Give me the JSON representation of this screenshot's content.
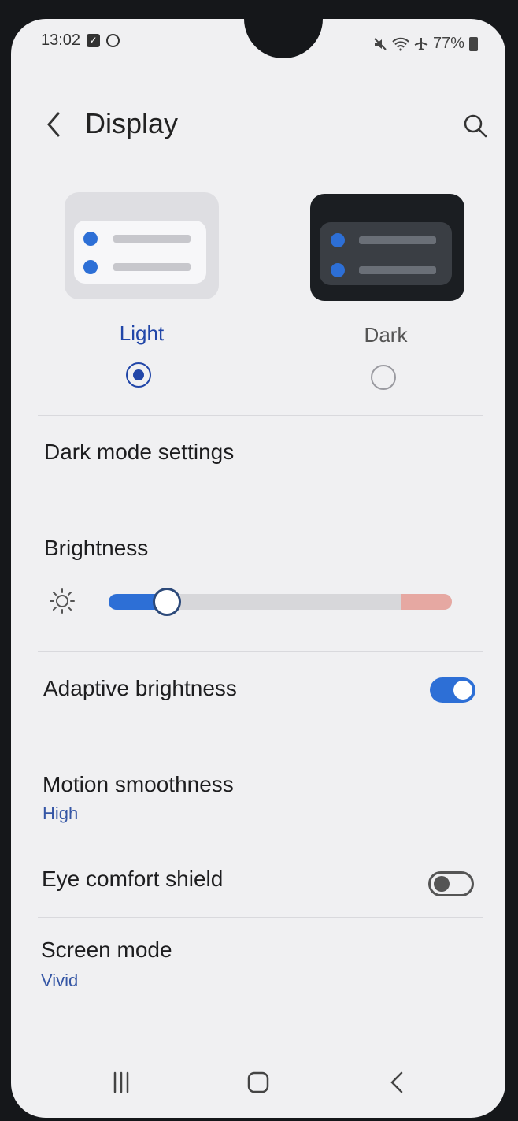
{
  "status_bar": {
    "time": "13:02",
    "battery": "77%",
    "icons": [
      "checkbox-icon",
      "sync-icon",
      "mute-icon",
      "wifi-icon",
      "airplane-icon",
      "battery-icon"
    ]
  },
  "header": {
    "title": "Display",
    "back_icon": "chevron-left-icon",
    "search_icon": "search-icon"
  },
  "themes": {
    "light": {
      "label": "Light",
      "selected": true
    },
    "dark": {
      "label": "Dark",
      "selected": false
    }
  },
  "dark_mode_settings": {
    "label": "Dark mode settings"
  },
  "brightness": {
    "label": "Brightness",
    "level": 0.17,
    "icon": "sun-icon"
  },
  "adaptive_brightness": {
    "label": "Adaptive brightness",
    "enabled": true
  },
  "motion_smoothness": {
    "label": "Motion smoothness",
    "value": "High"
  },
  "eye_comfort_shield": {
    "label": "Eye comfort shield",
    "enabled": false
  },
  "screen_mode": {
    "label": "Screen mode",
    "value": "Vivid"
  },
  "nav_bar": {
    "recents_icon": "recents-icon",
    "home_icon": "home-icon",
    "back_icon": "back-icon"
  },
  "colors": {
    "accent": "#2d6fd6",
    "selected_text": "#2146a8",
    "background": "#f0f0f2"
  }
}
